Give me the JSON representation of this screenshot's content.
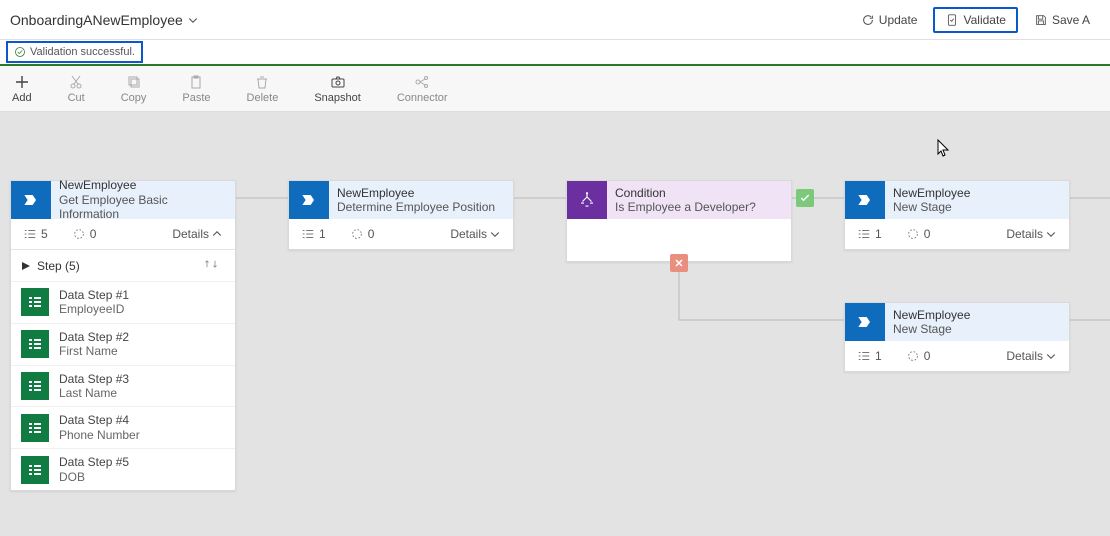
{
  "header": {
    "title": "OnboardingANewEmployee",
    "update_label": "Update",
    "validate_label": "Validate",
    "save_label": "Save A"
  },
  "validation": {
    "message": "Validation successful."
  },
  "toolbar": {
    "add": "Add",
    "cut": "Cut",
    "copy": "Copy",
    "paste": "Paste",
    "delete": "Delete",
    "snapshot": "Snapshot",
    "connector": "Connector"
  },
  "stages": {
    "stage1": {
      "entity": "NewEmployee",
      "name": "Get Employee Basic Information",
      "step_count": "5",
      "loop_count": "0",
      "details_label": "Details",
      "steps_header": "Step (5)",
      "steps": [
        {
          "title": "Data Step #1",
          "field": "EmployeeID"
        },
        {
          "title": "Data Step #2",
          "field": "First Name"
        },
        {
          "title": "Data Step #3",
          "field": "Last Name"
        },
        {
          "title": "Data Step #4",
          "field": "Phone Number"
        },
        {
          "title": "Data Step #5",
          "field": "DOB"
        }
      ]
    },
    "stage2": {
      "entity": "NewEmployee",
      "name": "Determine Employee Position",
      "step_count": "1",
      "loop_count": "0",
      "details_label": "Details"
    },
    "condition": {
      "title": "Condition",
      "name": "Is Employee a Developer?"
    },
    "stage3": {
      "entity": "NewEmployee",
      "name": "New Stage",
      "step_count": "1",
      "loop_count": "0",
      "details_label": "Details"
    },
    "stage4": {
      "entity": "NewEmployee",
      "name": "New Stage",
      "step_count": "1",
      "loop_count": "0",
      "details_label": "Details"
    }
  },
  "icons": {
    "chevron_down": "chevron-down-icon",
    "refresh": "refresh-icon",
    "clipboard": "clipboard-check-icon",
    "save": "save-icon",
    "check_circle": "check-circle-icon"
  }
}
